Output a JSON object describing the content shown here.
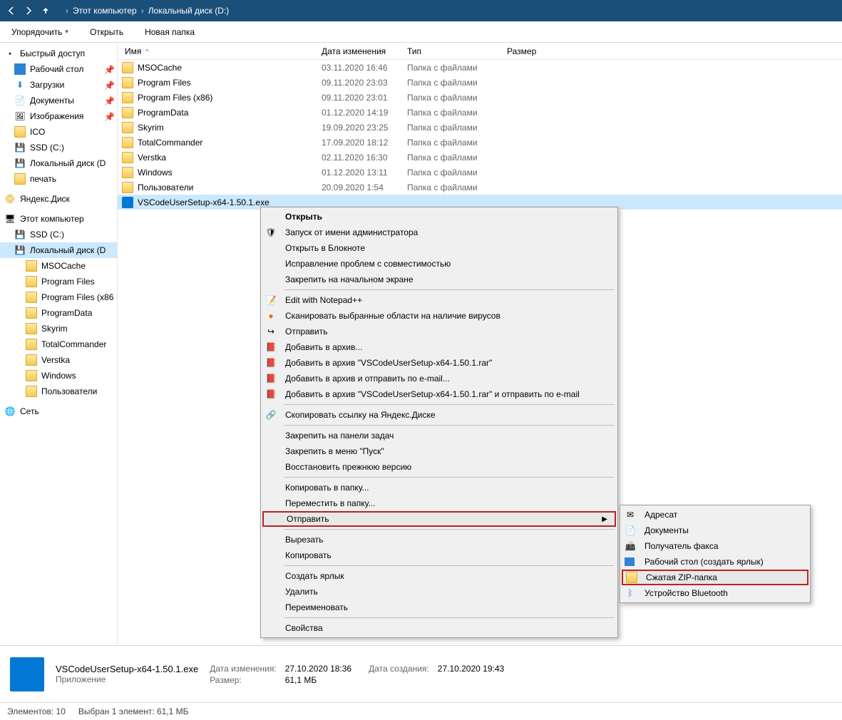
{
  "nav": {
    "breadcrumb": [
      "Этот компьютер",
      "Локальный диск (D:)"
    ]
  },
  "toolbar": {
    "organize": "Упорядочить",
    "open": "Открыть",
    "new_folder": "Новая папка"
  },
  "sidebar": {
    "quick_access": "Быстрый доступ",
    "desktop": "Рабочий стол",
    "downloads": "Загрузки",
    "documents": "Документы",
    "pictures": "Изображения",
    "ico": "ICO",
    "ssd": "SSD (C:)",
    "local_d": "Локальный диск (D",
    "print": "печать",
    "yandex": "Яндекс.Диск",
    "this_pc": "Этот компьютер",
    "ssd2": "SSD (C:)",
    "local_d2": "Локальный диск (D",
    "msocache": "MSOCache",
    "progfiles": "Program Files",
    "progfiles86": "Program Files (x86",
    "progdata": "ProgramData",
    "skyrim": "Skyrim",
    "totalcmd": "TotalCommander",
    "verstka": "Verstka",
    "windows": "Windows",
    "users": "Пользователи",
    "network": "Сеть"
  },
  "columns": {
    "name": "Имя",
    "date": "Дата изменения",
    "type": "Тип",
    "size": "Размер"
  },
  "files": [
    {
      "name": "MSOCache",
      "date": "03.11.2020 16:46",
      "type": "Папка с файлами"
    },
    {
      "name": "Program Files",
      "date": "09.11.2020 23:03",
      "type": "Папка с файлами"
    },
    {
      "name": "Program Files (x86)",
      "date": "09.11.2020 23:01",
      "type": "Папка с файлами"
    },
    {
      "name": "ProgramData",
      "date": "01.12.2020 14:19",
      "type": "Папка с файлами"
    },
    {
      "name": "Skyrim",
      "date": "19.09.2020 23:25",
      "type": "Папка с файлами"
    },
    {
      "name": "TotalCommander",
      "date": "17.09.2020 18:12",
      "type": "Папка с файлами"
    },
    {
      "name": "Verstka",
      "date": "02.11.2020 16:30",
      "type": "Папка с файлами"
    },
    {
      "name": "Windows",
      "date": "01.12.2020 13:11",
      "type": "Папка с файлами"
    },
    {
      "name": "Пользователи",
      "date": "20.09.2020 1:54",
      "type": "Папка с файлами"
    }
  ],
  "selected_file": {
    "name": "VSCodeUserSetup-x64-1.50.1.exe"
  },
  "context_menu": {
    "open": "Открыть",
    "run_admin": "Запуск от имени администратора",
    "open_notepad": "Открыть в Блокноте",
    "troubleshoot": "Исправление проблем с совместимостью",
    "pin_start": "Закрепить на начальном экране",
    "edit_npp": "Edit with Notepad++",
    "scan_virus": "Сканировать выбранные области на наличие вирусов",
    "send": "Отправить",
    "add_archive": "Добавить в архив...",
    "add_rar": "Добавить в архив \"VSCodeUserSetup-x64-1.50.1.rar\"",
    "add_email": "Добавить в архив и отправить по e-mail...",
    "add_rar_email": "Добавить в архив \"VSCodeUserSetup-x64-1.50.1.rar\" и отправить по e-mail",
    "copy_yandex": "Скопировать ссылку на Яндекс.Диске",
    "pin_taskbar": "Закрепить на панели задач",
    "pin_startmenu": "Закрепить в меню \"Пуск\"",
    "restore_version": "Восстановить прежнюю версию",
    "copy_to": "Копировать в папку...",
    "move_to": "Переместить в папку...",
    "send_to": "Отправить",
    "cut": "Вырезать",
    "copy": "Копировать",
    "create_shortcut": "Создать ярлык",
    "delete": "Удалить",
    "rename": "Переименовать",
    "properties": "Свойства"
  },
  "submenu": {
    "addressee": "Адресат",
    "documents": "Документы",
    "fax": "Получатель факса",
    "desktop_shortcut": "Рабочий стол (создать ярлык)",
    "zip": "Сжатая ZIP-папка",
    "bluetooth": "Устройство Bluetooth"
  },
  "details": {
    "name": "VSCodeUserSetup-x64-1.50.1.exe",
    "app_type": "Приложение",
    "date_mod_label": "Дата изменения:",
    "date_mod": "27.10.2020 18:36",
    "size_label": "Размер:",
    "size": "61,1 МБ",
    "date_created_label": "Дата создания:",
    "date_created": "27.10.2020 19:43"
  },
  "status": {
    "elements": "Элементов: 10",
    "selected": "Выбран 1 элемент: 61,1 МБ"
  }
}
